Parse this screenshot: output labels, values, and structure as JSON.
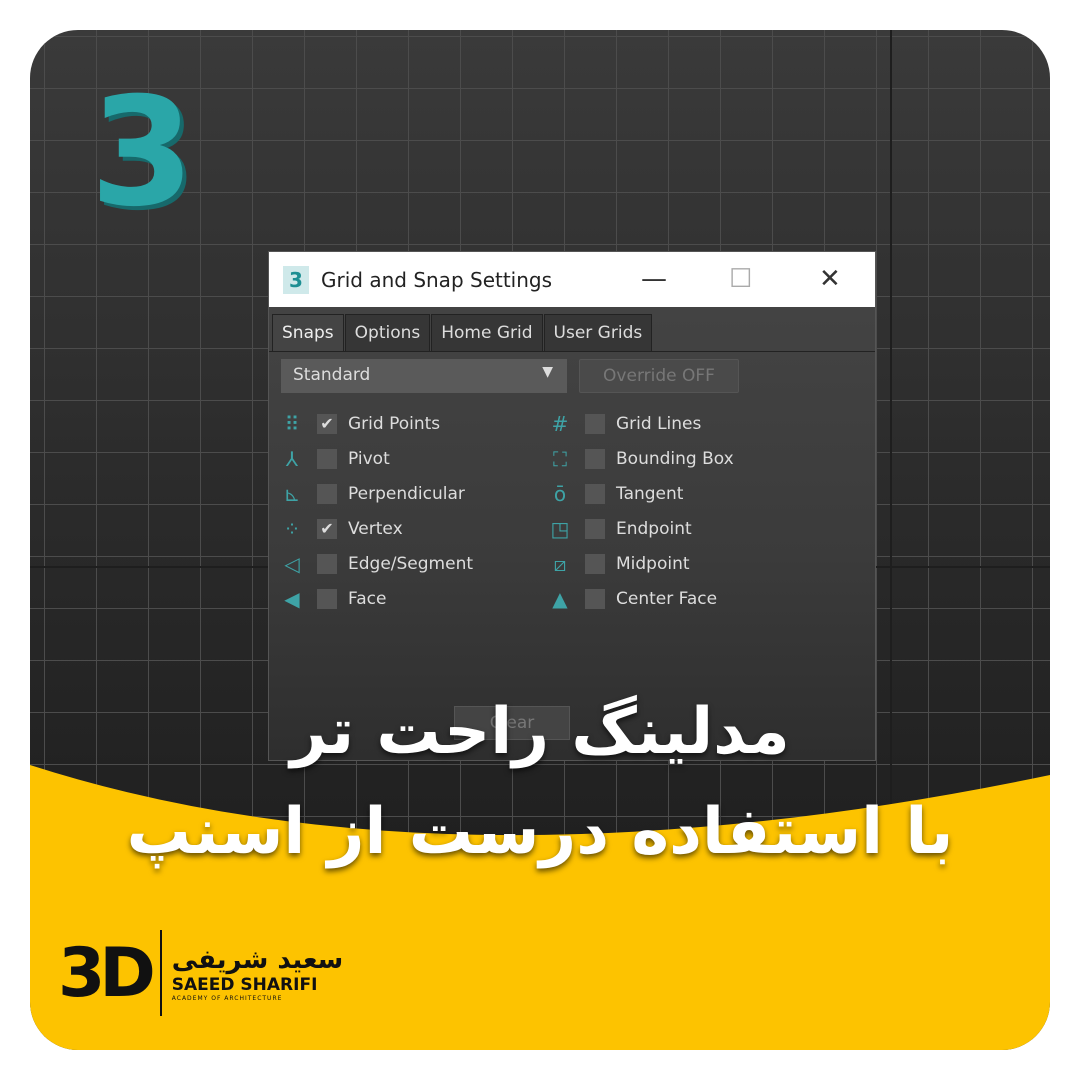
{
  "window": {
    "title": "Grid and Snap Settings",
    "min": "—",
    "max": "☐",
    "close": "✕",
    "app_icon": "3"
  },
  "tabs": [
    {
      "label": "Snaps",
      "active": true
    },
    {
      "label": "Options"
    },
    {
      "label": "Home Grid"
    },
    {
      "label": "User Grids"
    }
  ],
  "dropdown": {
    "value": "Standard",
    "arrow": "▼"
  },
  "override_label": "Override OFF",
  "snaps_left": [
    {
      "label": "Grid Points",
      "checked": true,
      "icon": "grid-points-icon",
      "glyph": "⠿"
    },
    {
      "label": "Pivot",
      "checked": false,
      "icon": "pivot-icon",
      "glyph": "⅄"
    },
    {
      "label": "Perpendicular",
      "checked": false,
      "icon": "perpendicular-icon",
      "glyph": "⊾"
    },
    {
      "label": "Vertex",
      "checked": true,
      "icon": "vertex-icon",
      "glyph": "⁘"
    },
    {
      "label": "Edge/Segment",
      "checked": false,
      "icon": "edge-segment-icon",
      "glyph": "◁"
    },
    {
      "label": "Face",
      "checked": false,
      "icon": "face-icon",
      "glyph": "◀"
    }
  ],
  "snaps_right": [
    {
      "label": "Grid Lines",
      "checked": false,
      "icon": "grid-lines-icon",
      "glyph": "#"
    },
    {
      "label": "Bounding Box",
      "checked": false,
      "icon": "bounding-box-icon",
      "glyph": "⛶"
    },
    {
      "label": "Tangent",
      "checked": false,
      "icon": "tangent-icon",
      "glyph": "ō"
    },
    {
      "label": "Endpoint",
      "checked": false,
      "icon": "endpoint-icon",
      "glyph": "◳"
    },
    {
      "label": "Midpoint",
      "checked": false,
      "icon": "midpoint-icon",
      "glyph": "⧄"
    },
    {
      "label": "Center Face",
      "checked": false,
      "icon": "center-face-icon",
      "glyph": "▲"
    }
  ],
  "clear_label": "Clear",
  "check_glyph": "✔",
  "headline": {
    "line1": "مدلینگ راحت تر",
    "line2": "با استفاده درست از اسنپ"
  },
  "brand": {
    "mark": "3D",
    "persian": "سعید شریفی",
    "name": "SAEED SHARIFI",
    "tagline": "ACADEMY OF ARCHITECTURE"
  },
  "logo_glyph": "3",
  "colors": {
    "accent": "#3ea3a6",
    "yellow": "#fdc300",
    "background": "#2b2b2b"
  }
}
